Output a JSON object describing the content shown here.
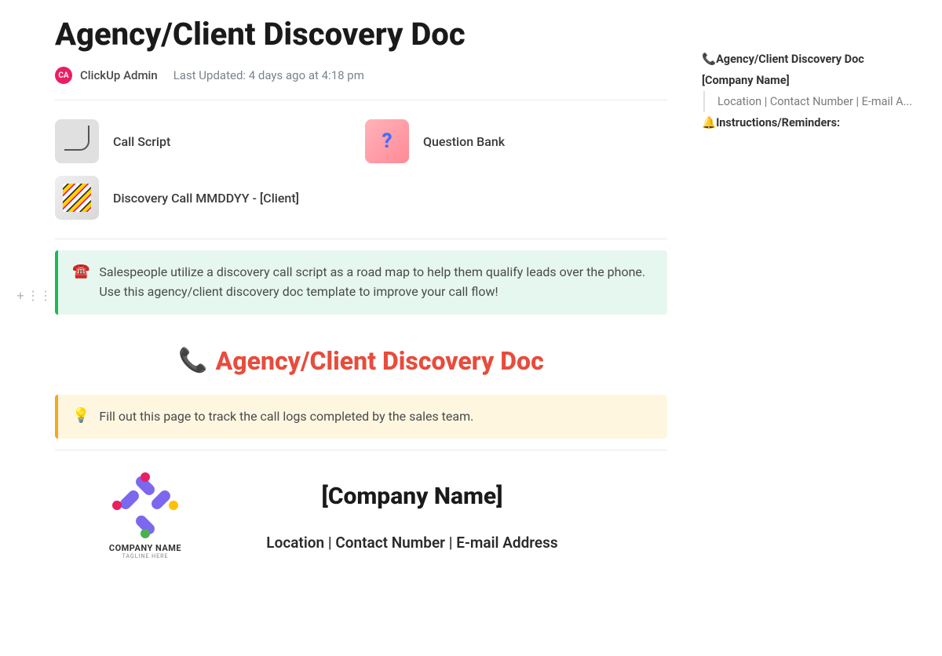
{
  "title": "Agency/Client Discovery Doc",
  "author": {
    "initials": "CA",
    "name": "ClickUp Admin"
  },
  "meta": {
    "updated_prefix": "Last Updated: ",
    "updated_value": "4 days ago at 4:18 pm"
  },
  "subpages": [
    {
      "label": "Call Script",
      "thumb_style": "cord"
    },
    {
      "label": "Question Bank",
      "thumb_style": "pink",
      "glyph": "?"
    },
    {
      "label": "Discovery Call MMDDYY - [Client]",
      "thumb_style": "files"
    }
  ],
  "callout_green": {
    "icon": "☎️",
    "text": "Salespeople utilize a discovery call script as a road map to help them qualify leads over the phone. Use this agency/client discovery doc template to improve your call flow!"
  },
  "section_heading": {
    "icon": "📞",
    "text": "Agency/Client Discovery Doc"
  },
  "callout_yellow": {
    "icon": "💡",
    "text": "Fill out this page to track the call logs completed by the sales team."
  },
  "company": {
    "logo_name": "COMPANY NAME",
    "logo_tagline": "TAGLINE HERE",
    "name": "[Company Name]",
    "contact": "Location | Contact Number | E-mail Address"
  },
  "outline": [
    {
      "icon": "📞",
      "label": "Agency/Client Discovery Doc",
      "bold": true
    },
    {
      "icon": "",
      "label": "[Company Name]",
      "bold": true
    },
    {
      "icon": "",
      "label": "Location | Contact Number | E-mail A...",
      "sub": true
    },
    {
      "icon": "🔔",
      "label": "Instructions/Reminders:",
      "bold": true
    }
  ]
}
